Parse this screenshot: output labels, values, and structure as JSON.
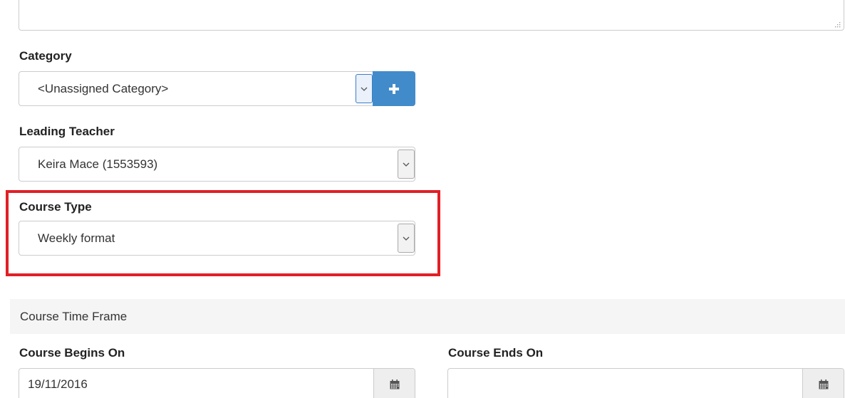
{
  "description_field": {
    "value": ""
  },
  "category": {
    "label": "Category",
    "selected": "<Unassigned Category>",
    "add_icon": "plus-icon"
  },
  "leading_teacher": {
    "label": "Leading Teacher",
    "selected": "Keira Mace (1553593)"
  },
  "course_type": {
    "label": "Course Type",
    "selected": "Weekly format"
  },
  "time_frame": {
    "header": "Course Time Frame",
    "begins": {
      "label": "Course Begins On",
      "value": "19/11/2016"
    },
    "ends": {
      "label": "Course Ends On",
      "value": ""
    },
    "calendar_icon": "calendar-icon"
  },
  "colors": {
    "primary": "#428bca",
    "highlight": "#e21f26",
    "section_bg": "#f5f5f5"
  }
}
